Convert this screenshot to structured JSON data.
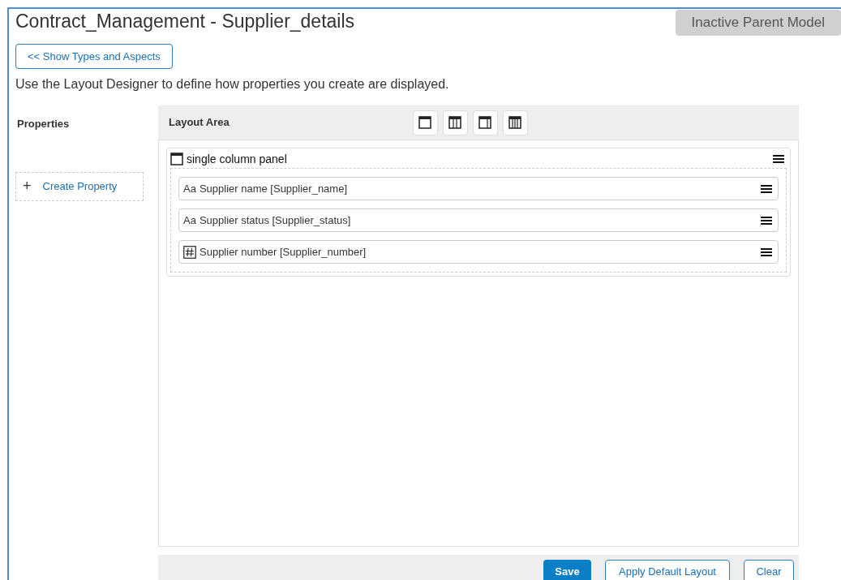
{
  "title": "Contract_Management - Supplier_details",
  "badge": "Inactive Parent Model",
  "back_button": "<< Show Types and Aspects",
  "description": "Use the Layout Designer to define how properties you create are displayed.",
  "properties": {
    "heading": "Properties",
    "create_icon": "+",
    "create_label": "Create Property"
  },
  "layout_area": {
    "heading": "Layout Area",
    "panel": {
      "title": "single column panel",
      "fields": [
        {
          "kind": "text",
          "prefix": "Aa",
          "label": "Supplier name [Supplier_name]"
        },
        {
          "kind": "text",
          "prefix": "Aa",
          "label": "Supplier status [Supplier_status]"
        },
        {
          "kind": "number",
          "label": "Supplier number [Supplier_number]"
        }
      ]
    }
  },
  "buttons": {
    "save": "Save",
    "apply": "Apply Default Layout",
    "clear": "Clear"
  }
}
